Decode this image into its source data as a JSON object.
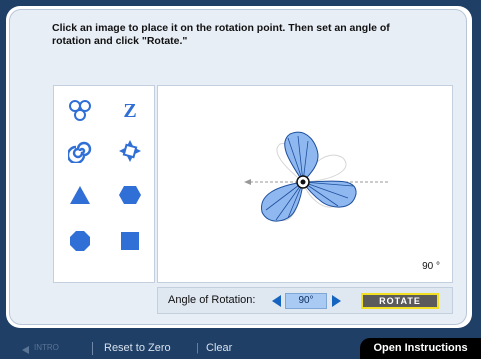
{
  "instructions": "Click an image to place it on the rotation point. Then set an angle of rotation and click \"Rotate.\"",
  "palette": {
    "items": [
      "trefoil-icon",
      "letter-z",
      "spiral-icon",
      "pinwheel-icon",
      "triangle-icon",
      "hexagon-icon",
      "octagon-icon",
      "square-icon"
    ],
    "letter_z": "Z"
  },
  "canvas": {
    "angle_display": "90 °",
    "current_shape": "trefoil"
  },
  "controls": {
    "label": "Angle of Rotation:",
    "angle_value": "90°",
    "rotate_label": "ROTATE"
  },
  "bottom_bar": {
    "intro": "INTRO",
    "reset": "Reset to Zero",
    "separator": "|",
    "clear": "Clear",
    "open_instructions": "Open Instructions"
  },
  "colors": {
    "background": "#1f3f66",
    "shape_fill": "#2f6fd6",
    "accent": "#1565c0",
    "rotate_border": "#f2e022"
  }
}
